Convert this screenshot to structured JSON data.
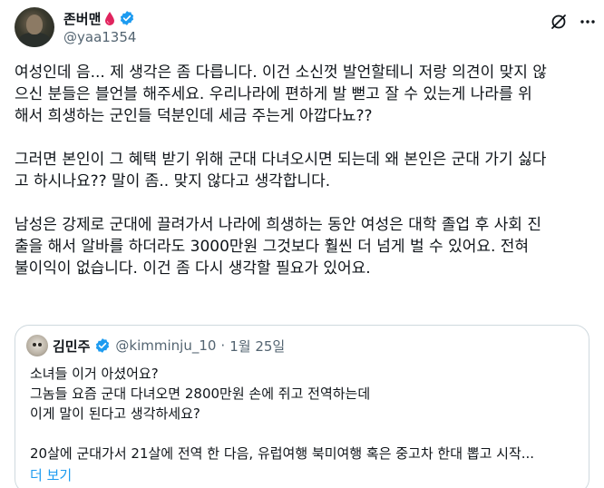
{
  "author": {
    "display_name": "존버맨",
    "handle": "@yaa1354",
    "badge_color": "#1d9bf0",
    "emoji": "blood-drop"
  },
  "post": {
    "paragraphs": [
      [
        "여성인데 음... 제 생각은 좀 다릅니다. 이건 소신껏 발언할테니 저랑 의견이 맞지 않",
        "으신 분들은 블언블 해주세요. 우리나라에 편하게 발 뻗고 잘 수 있는게 나라를 위",
        "해서 희생하는 군인들 덕분인데 세금 주는게 아깝다뇨??"
      ],
      [
        "그러면 본인이 그 혜택 받기 위해 군대 다녀오시면 되는데 왜 본인은 군대 가기 싫다",
        "고 하시나요?? 말이 좀.. 맞지 않다고 생각합니다."
      ],
      [
        "남성은 강제로 군대에 끌려가서 나라에 희생하는 동안 여성은 대학 졸업 후 사회 진",
        "출을 해서 알바를 하더라도 3000만원 그것보다 훨씬 더 넘게 벌 수 있어요. 전혀",
        "불이익이 없습니다. 이건 좀 다시 생각할 필요가 있어요."
      ]
    ]
  },
  "quote": {
    "display_name": "김민주",
    "handle": "@kimminju_10",
    "separator": "·",
    "date": "1월 25일",
    "lines": [
      "소녀들 이거 아셨어요?",
      "그놈들 요즘 군대 다녀오면 2800만원 손에 쥐고 전역하는데",
      "이게 말이 된다고 생각하세요?",
      "",
      "20살에 군대가서 21살에 전역 한 다음, 유럽여행 북미여행 혹은 중고차 한대 뽑고 시작..."
    ],
    "show_more": "더 보기"
  },
  "icons": {
    "grok": "grok-icon",
    "more": "more-options-icon",
    "verified": "verified-badge-icon"
  }
}
